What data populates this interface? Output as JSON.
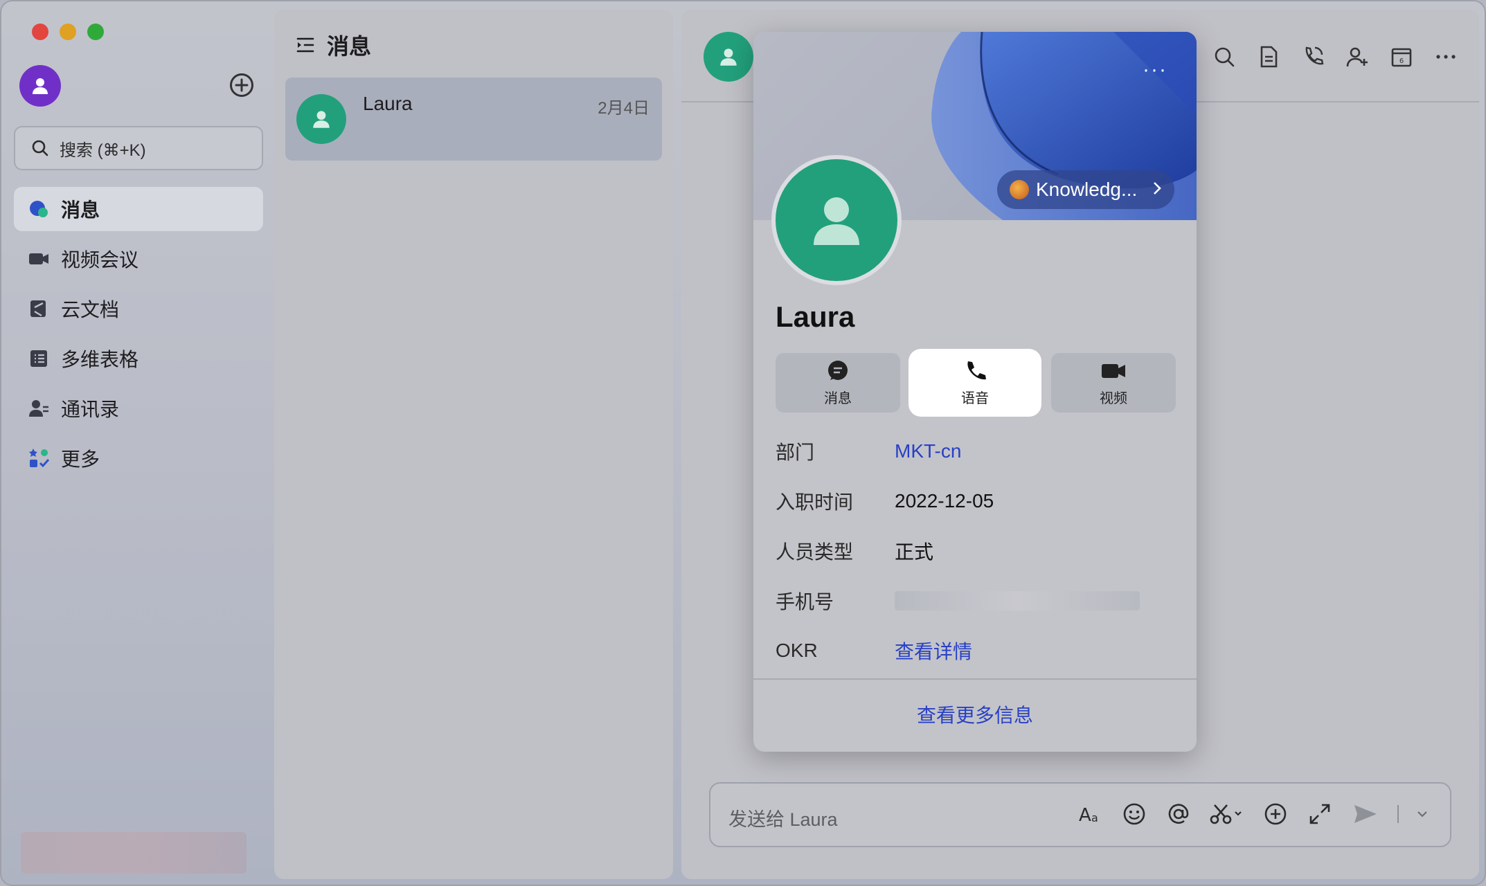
{
  "sidebar": {
    "search": {
      "placeholder": "搜索 (⌘+K)"
    },
    "items": [
      {
        "label": "消息",
        "icon": "message-bubble-icon",
        "active": true
      },
      {
        "label": "视频会议",
        "icon": "video-camera-icon"
      },
      {
        "label": "云文档",
        "icon": "cloud-doc-icon"
      },
      {
        "label": "多维表格",
        "icon": "table-grid-icon"
      },
      {
        "label": "通讯录",
        "icon": "contacts-icon"
      },
      {
        "label": "更多",
        "icon": "apps-grid-icon"
      }
    ]
  },
  "chatlist": {
    "title": "消息",
    "items": [
      {
        "name": "Laura",
        "date": "2月4日"
      }
    ]
  },
  "conversation": {
    "composer_placeholder": "发送给 Laura",
    "header_tools": [
      "search-icon",
      "document-icon",
      "phone-call-icon",
      "add-person-icon",
      "calendar-icon",
      "more-icon"
    ],
    "composer_tools": [
      "font-format-icon",
      "emoji-icon",
      "mention-icon",
      "scissors-icon",
      "plus-circle-icon",
      "expand-icon",
      "send-icon"
    ]
  },
  "profile_card": {
    "more_label": "···",
    "badge_label": "Knowledg...",
    "name": "Laura",
    "actions": [
      {
        "label": "消息",
        "icon": "chat-bubble-icon"
      },
      {
        "label": "语音",
        "icon": "phone-icon",
        "highlighted": true
      },
      {
        "label": "视频",
        "icon": "video-icon"
      }
    ],
    "fields": [
      {
        "label": "部门",
        "value": "MKT-cn",
        "link": true
      },
      {
        "label": "入职时间",
        "value": "2022-12-05"
      },
      {
        "label": "人员类型",
        "value": "正式"
      },
      {
        "label": "手机号",
        "value": ""
      },
      {
        "label": "OKR",
        "value": "查看详情",
        "link": true
      }
    ],
    "footer_link": "查看更多信息"
  },
  "colors": {
    "accent_link": "#2940c4",
    "avatar_green": "#22a07c",
    "user_avatar_purple": "#7030c8"
  }
}
